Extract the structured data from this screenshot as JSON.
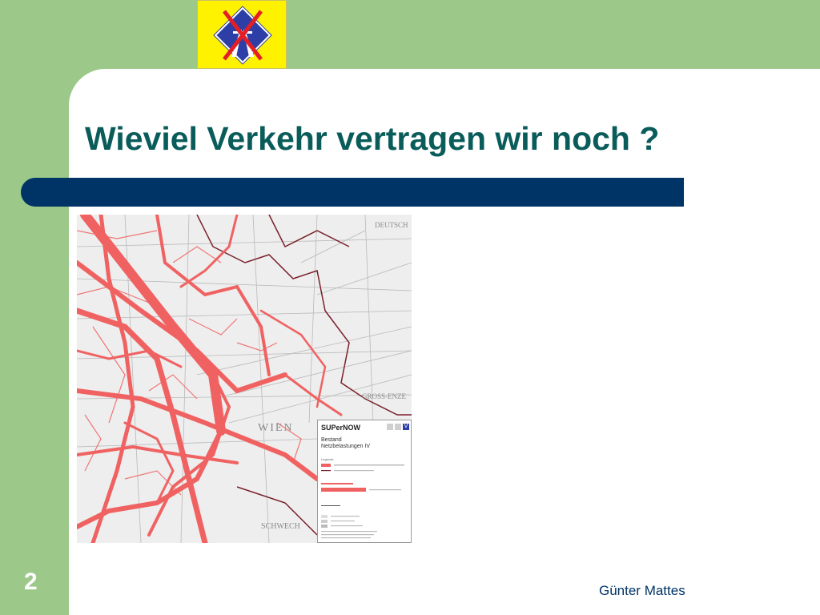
{
  "slide": {
    "title": "Wieviel Verkehr vertragen wir noch ?",
    "number": "2",
    "footer": "Günter Mattes"
  },
  "map": {
    "place_labels": [
      "WIEN",
      "DEUTSCH",
      "GROSS-ENZE",
      "SCHWECH"
    ],
    "legend": {
      "brand": "SUPerNOW",
      "status": "Bestand",
      "subtitle": "Netzbelastungen IV"
    }
  },
  "colors": {
    "background": "#9cc98a",
    "title": "#0a5c5a",
    "bar": "#003366",
    "logo_bg": "#fff200",
    "logo_blue": "#2d3fa6",
    "logo_cross": "#e31e24",
    "road_load": "#f06262"
  },
  "icons": {
    "logo": "motorway-crossed-out-icon"
  }
}
